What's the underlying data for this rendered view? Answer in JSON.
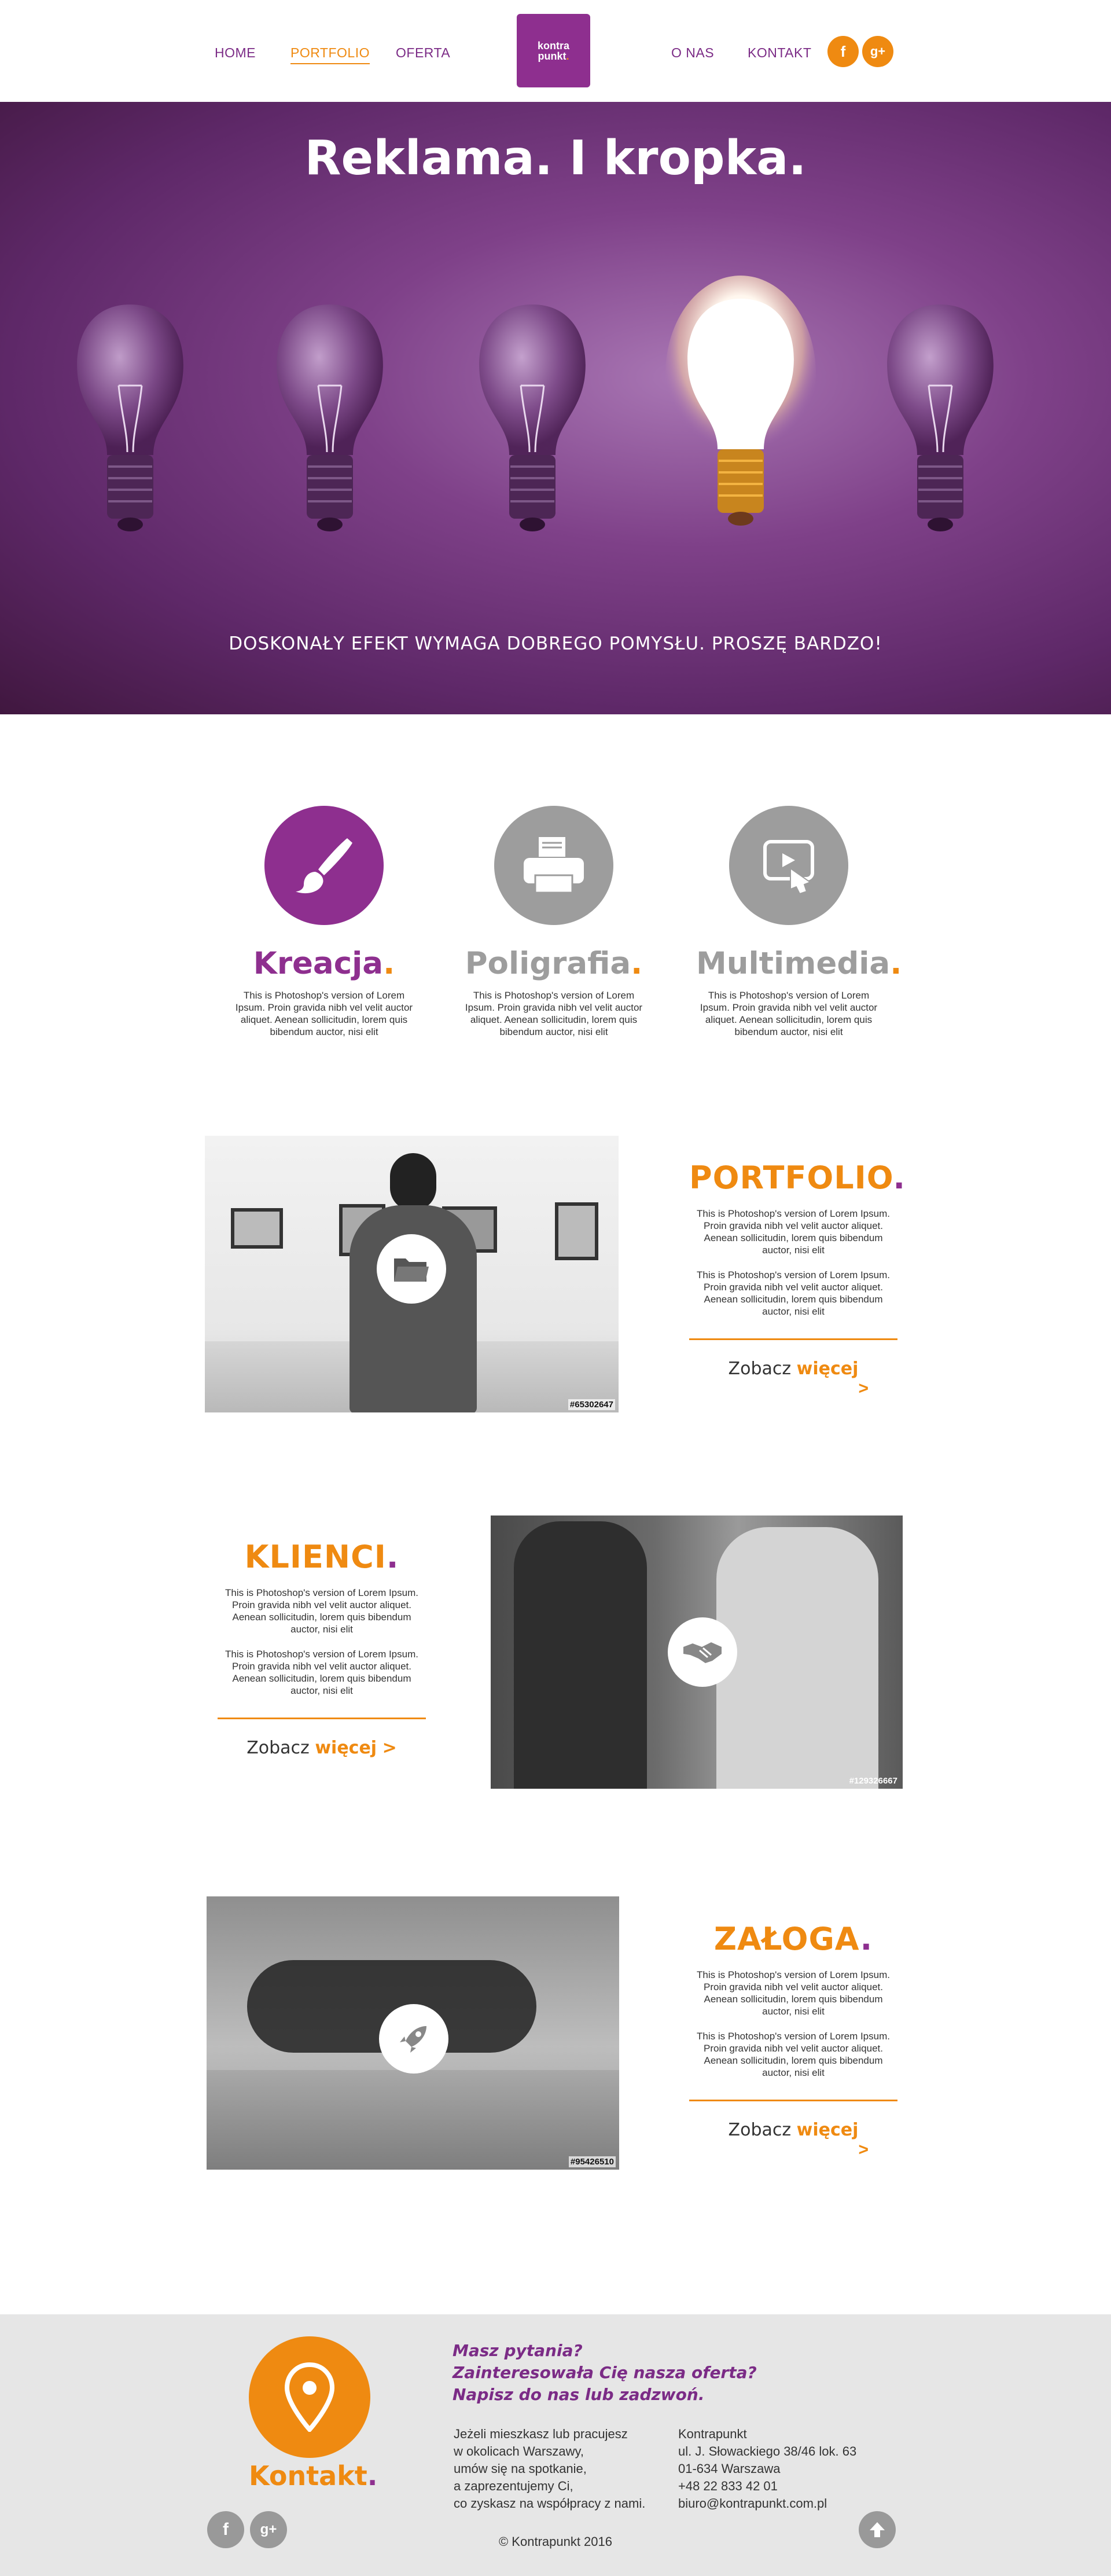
{
  "header": {
    "nav_left": [
      "HOME",
      "PORTFOLIO",
      "OFERTA"
    ],
    "nav_right": [
      "O NAS",
      "KONTAKT"
    ],
    "logo_line1": "kontra",
    "logo_line2": "punkt",
    "social": [
      "f",
      "g+"
    ]
  },
  "hero": {
    "title": "Reklama. I kropka.",
    "subtitle": "DOSKONAŁY EFEKT WYMAGA DOBREGO POMYSŁU. PROSZĘ BARDZO!"
  },
  "services": [
    {
      "title": "Kreacja",
      "text": "This is Photoshop's version  of Lorem Ipsum. Proin gravida nibh vel velit auctor aliquet. Aenean sollicitudin, lorem quis bibendum auctor, nisi elit",
      "icon": "brush-icon"
    },
    {
      "title": "Poligrafia",
      "text": "This is Photoshop's version  of Lorem Ipsum. Proin gravida nibh vel velit auctor aliquet. Aenean sollicitudin, lorem quis bibendum auctor, nisi elit",
      "icon": "printer-icon"
    },
    {
      "title": "Multimedia",
      "text": "This is Photoshop's version  of Lorem Ipsum. Proin gravida nibh vel velit auctor aliquet. Aenean sollicitudin, lorem quis bibendum auctor, nisi elit",
      "icon": "touch-screen-icon"
    }
  ],
  "portfolio": {
    "title": "PORTFOLIO",
    "text1": "This is Photoshop's version  of Lorem Ipsum. Proin gravida nibh vel velit auctor aliquet. Aenean sollicitudin, lorem quis bibendum auctor, nisi elit",
    "text2": "This is Photoshop's version  of Lorem Ipsum. Proin gravida nibh vel velit auctor aliquet. Aenean sollicitudin, lorem quis bibendum auctor, nisi elit",
    "more_prefix": "Zobacz",
    "more_bold": "więcej",
    "arrow": ">",
    "photo_tag": "#65302647"
  },
  "klienci": {
    "title": "KLIENCI",
    "text1": "This is Photoshop's version  of Lorem Ipsum. Proin gravida nibh vel velit auctor aliquet. Aenean sollicitudin, lorem quis bibendum auctor, nisi elit",
    "text2": "This is Photoshop's version  of Lorem Ipsum. Proin gravida nibh vel velit auctor aliquet. Aenean sollicitudin, lorem quis bibendum auctor, nisi elit",
    "more_prefix": "Zobacz",
    "more_bold": "więcej",
    "arrow": ">",
    "photo_tag": "#129326667"
  },
  "zaloga": {
    "title": "ZAŁOGA",
    "text1": "This is Photoshop's version  of Lorem Ipsum. Proin gravida nibh vel velit auctor aliquet. Aenean sollicitudin, lorem quis bibendum auctor, nisi elit",
    "text2": "This is Photoshop's version  of Lorem Ipsum. Proin gravida nibh vel velit auctor aliquet. Aenean sollicitudin, lorem quis bibendum auctor, nisi elit",
    "more_prefix": "Zobacz",
    "more_bold": "więcej",
    "arrow": ">",
    "photo_tag": "#95426510"
  },
  "footer": {
    "heading": "Kontakt",
    "questions": [
      "Masz pytania?",
      "Zainteresowała Cię nasza oferta?",
      "Napisz do nas lub zadzwoń."
    ],
    "left_lines": [
      "Jeżeli mieszkasz lub pracujesz",
      "w okolicach Warszawy,",
      "umów się na spotkanie,",
      "a zaprezentujemy Ci,",
      "co zyskasz na współpracy z nami."
    ],
    "right_lines": [
      "Kontrapunkt",
      "ul. J. Słowackiego 38/46 lok. 63",
      "01-634 Warszawa",
      "+48 22 833 42 01",
      "biuro@kontrapunkt.com.pl"
    ],
    "copyright": "© Kontrapunkt 2016",
    "social": [
      "f",
      "g+"
    ]
  },
  "colors": {
    "purple": "#8e2f8f",
    "orange": "#ef8a11",
    "grey": "#9d9d9d"
  }
}
